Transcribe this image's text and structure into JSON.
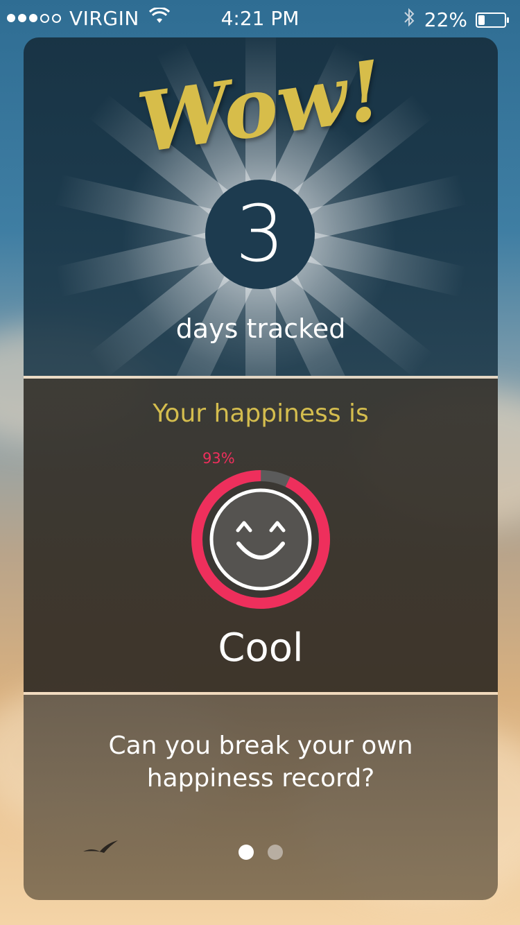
{
  "status_bar": {
    "signal_dots": 5,
    "signal_filled": 3,
    "carrier": "VIRGIN",
    "time": "4:21 PM",
    "battery_text": "22%",
    "battery_level": 0.22
  },
  "streak": {
    "headline": "Wow!",
    "count": "3",
    "caption": "days tracked"
  },
  "happiness": {
    "title": "Your happiness is",
    "percent_label": "93%",
    "percent_value": 93,
    "mood": "Cool",
    "ring_color": "#ee2f5c"
  },
  "challenge": {
    "line1": "Can you break your own",
    "line2": "happiness record?"
  },
  "pager": {
    "pages": 2,
    "active": 1
  },
  "colors": {
    "accent_gold": "#d7bd4a",
    "accent_pink": "#ee2f5c"
  }
}
